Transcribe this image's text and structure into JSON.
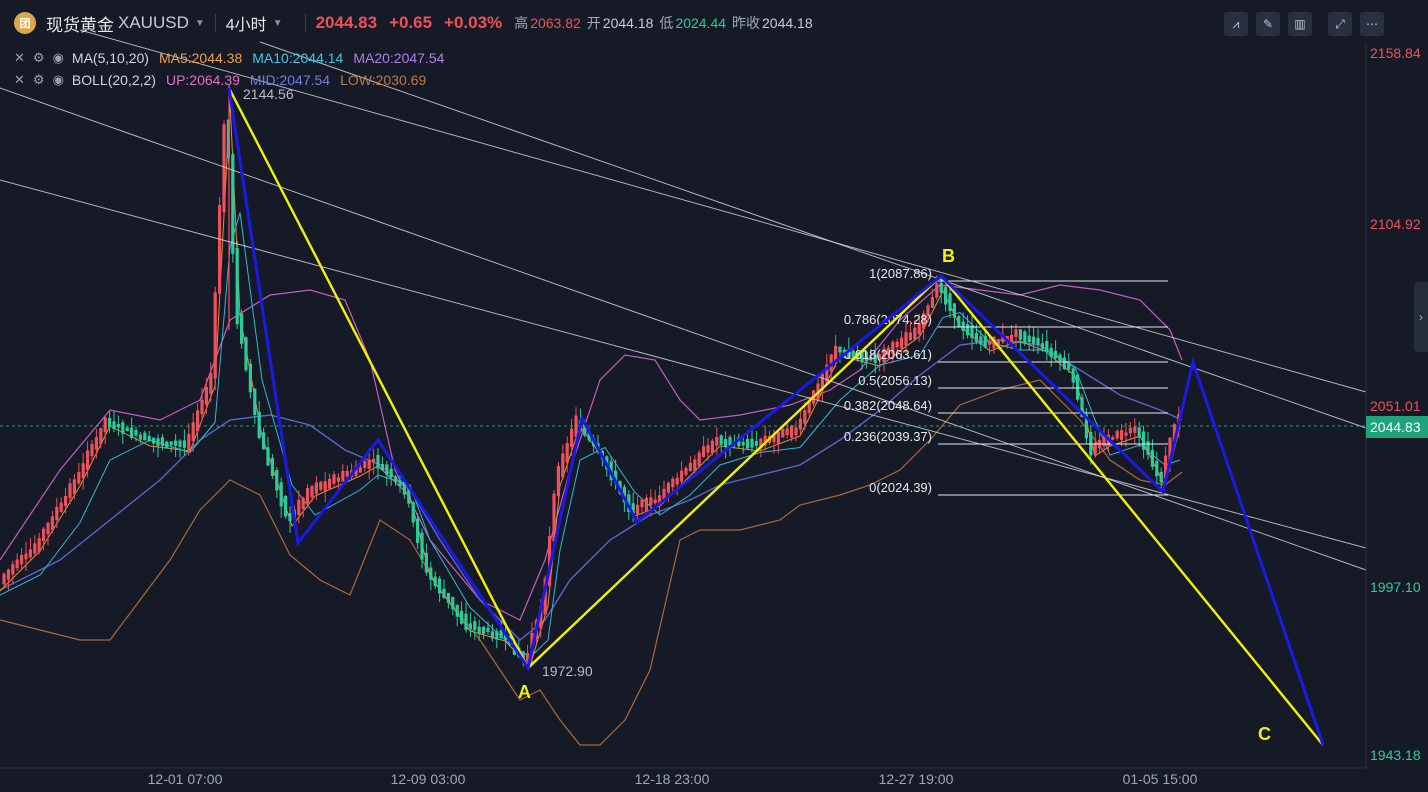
{
  "header": {
    "logo_text": "团",
    "symbol_name": "现货黄金",
    "symbol_code": "XAUUSD",
    "timeframe": "4小时",
    "last_price": "2044.83",
    "change": "+0.65",
    "change_pct": "+0.03%",
    "high_label": "高",
    "high": "2063.82",
    "open_label": "开",
    "open": "2044.18",
    "low_label": "低",
    "low": "2024.44",
    "prev_label": "昨收",
    "prev_close": "2044.18"
  },
  "indicators": [
    {
      "name": "MA(5,10,20)",
      "values": [
        {
          "text": "MA5:2044.38",
          "color": "#f0a04a"
        },
        {
          "text": "MA10:2044.14",
          "color": "#3ec6e6"
        },
        {
          "text": "MA20:2047.54",
          "color": "#b07ee8"
        }
      ]
    },
    {
      "name": "BOLL(20,2,2)",
      "values": [
        {
          "text": "UP:2064.39",
          "color": "#e070d0"
        },
        {
          "text": "MID:2047.54",
          "color": "#6f7fe0"
        },
        {
          "text": "LOW:2030.69",
          "color": "#b87a4a"
        }
      ]
    }
  ],
  "price_axis": {
    "ticks": [
      {
        "text": "2158.84",
        "color": "#f0505a"
      },
      {
        "text": "2104.92",
        "color": "#f0505a"
      },
      {
        "text": "2051.01",
        "color": "#f0505a"
      },
      {
        "text": "1997.10",
        "color": "#2ecb9a"
      },
      {
        "text": "1943.18",
        "color": "#2ecb9a"
      }
    ],
    "current": "2044.83"
  },
  "time_axis": [
    "12-01 07:00",
    "12-09 03:00",
    "12-18 23:00",
    "12-27 19:00",
    "01-05 15:00"
  ],
  "annotations": {
    "high_mark": "2144.56",
    "low_mark": "1972.90",
    "A": "A",
    "B": "B",
    "C": "C"
  },
  "fib_levels": [
    "1(2087.86)",
    "0.786(2074.28)",
    "0.618(2063.61)",
    "0.5(2056.13)",
    "0.382(2048.64)",
    "0.236(2039.37)",
    "0(2024.39)"
  ],
  "colors": {
    "up": "#f0505a",
    "down": "#2ecb9a",
    "zigzag_blue": "#1a1ae6",
    "zigzag_yellow": "#f2f200"
  },
  "icons": [
    "close-icon",
    "settings-icon",
    "eye-icon",
    "chevron-right-icon"
  ]
}
